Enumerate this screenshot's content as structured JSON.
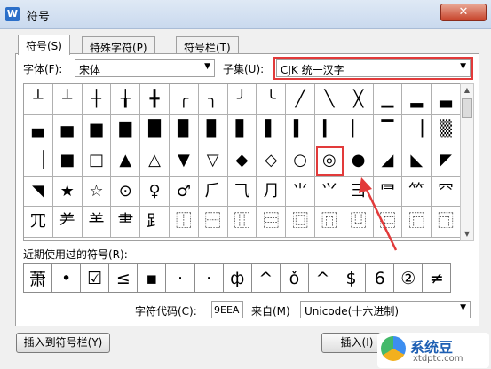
{
  "window": {
    "title": "符号",
    "close_label": "✕"
  },
  "tabs": [
    {
      "label": "符号(S)",
      "active": true
    },
    {
      "label": "特殊字符(P)",
      "active": false
    },
    {
      "label": "符号栏(T)",
      "active": false
    }
  ],
  "font": {
    "label": "字体(F):",
    "value": "宋体"
  },
  "subset": {
    "label": "子集(U):",
    "value": "CJK 统一汉字"
  },
  "symbols": [
    "┴",
    "┴",
    "┼",
    "╁",
    "╋",
    "╭",
    "╮",
    "╯",
    "╰",
    "╱",
    "╲",
    "╳",
    "▁",
    "▂",
    "▃",
    "▄",
    "▅",
    "▆",
    "▇",
    "█",
    "▉",
    "▊",
    "▋",
    "▌",
    "▍",
    "▎",
    "▏",
    "▔",
    "▕",
    "▒",
    "▕",
    "■",
    "□",
    "▲",
    "△",
    "▼",
    "▽",
    "◆",
    "◇",
    "○",
    "◎",
    "●",
    "◢",
    "◣",
    "◤",
    "◥",
    "★",
    "☆",
    "⊙",
    "♀",
    "♂",
    "⺁",
    "⺄",
    "⺆",
    "⺌",
    "⺍",
    "⺕",
    "⺜",
    "⺮",
    "⺳",
    "⺴",
    "⺶",
    "⺷",
    "⺻",
    "⻊",
    "⿰",
    "⿱",
    "⿲",
    "⿳",
    "⿴",
    "⿵",
    "⿶",
    "⿷",
    "⿸",
    "⿹"
  ],
  "selected_symbol": "◎",
  "recent": {
    "label": "近期使用过的符号(R):",
    "items": [
      "萧",
      "•",
      "☑",
      "≤",
      "▪",
      "·",
      "·",
      "ф",
      "^",
      "ǒ",
      "^",
      "$",
      "6",
      "②",
      "≠"
    ]
  },
  "char_code": {
    "label": "字符代码(C):",
    "value": "9EEA"
  },
  "from": {
    "label": "来自(M)",
    "value": "Unicode(十六进制)"
  },
  "buttons": {
    "insert_to_bar": "插入到符号栏(Y)",
    "insert": "插入(I)"
  },
  "watermark": {
    "title": "系统豆",
    "url": "xtdptc.com"
  }
}
